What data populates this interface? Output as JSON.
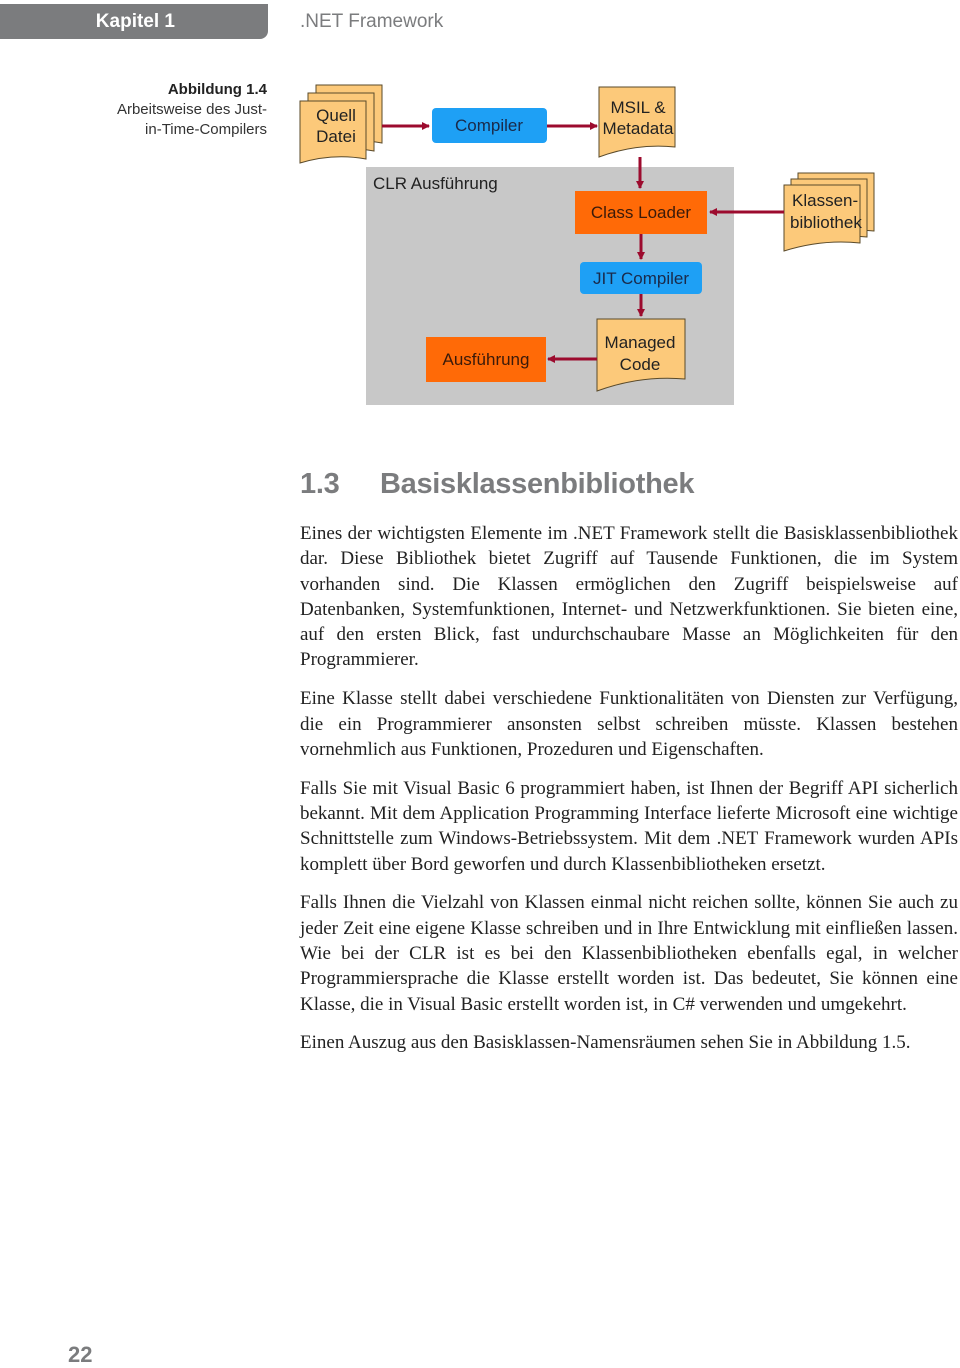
{
  "header": {
    "chapter_label": "Kapitel 1",
    "running_title": ".NET Framework"
  },
  "figure": {
    "number": "Abbildung 1.4",
    "caption_line1": "Arbeitsweise des Just-",
    "caption_line2": "in-Time-Compilers",
    "colors": {
      "document_fill": "#fcc97a",
      "process_blue": "#1ea0f5",
      "process_orange": "#ff6a07",
      "container_gray": "#c8c8c8",
      "arrow": "#9c0b2e"
    },
    "nodes": {
      "source_file": {
        "line1": "Quell",
        "line2": "Datei"
      },
      "compiler": "Compiler",
      "msil": {
        "line1": "MSIL &",
        "line2": "Metadata"
      },
      "clr_container": "CLR Ausführung",
      "class_loader": "Class Loader",
      "class_library": {
        "line1": "Klassen-",
        "line2": "bibliothek"
      },
      "jit_compiler": "JIT Compiler",
      "managed_code": {
        "line1": "Managed",
        "line2": "Code"
      },
      "execution": "Ausführung"
    }
  },
  "section": {
    "number": "1.3",
    "title": "Basisklassenbibliothek"
  },
  "paragraphs": [
    "Eines der wichtigsten Elemente im .NET Framework stellt die Basisklassenbibliothek dar. Diese Bibliothek bietet Zugriff auf Tausende Funktionen, die im System vorhanden sind. Die Klassen ermöglichen den Zugriff beispielsweise auf Datenbanken, Systemfunktionen, Internet- und Netzwerkfunktionen. Sie bieten eine, auf den ersten Blick, fast undurch­schaubare Masse an Möglichkeiten für den Programmierer.",
    "Eine Klasse stellt dabei verschiedene Funktionalitäten von Diensten zur Verfügung, die ein Programmierer ansonsten selbst schreiben müsste. Klas­sen bestehen vornehmlich aus Funktionen, Prozeduren und Eigenschaften.",
    "Falls Sie mit Visual Basic 6 programmiert haben, ist Ihnen der Begriff API sicherlich bekannt. Mit dem Application Programming Interface lieferte Microsoft eine wichtige Schnittstelle zum Windows-Betriebssystem. Mit dem .NET Framework wurden APIs komplett über Bord geworfen und durch Klas­senbibliotheken ersetzt.",
    "Falls Ihnen die Vielzahl von Klassen einmal nicht reichen sollte, können Sie auch zu jeder Zeit eine eigene Klasse schreiben und in Ihre Entwicklung mit einfließen lassen. Wie bei der CLR ist es bei den Klassenbibliotheken eben­falls egal, in welcher Programmiersprache die Klasse erstellt worden ist. Das bedeutet, Sie können eine Klasse, die in Visual Basic erstellt worden ist, in C# verwenden und umgekehrt.",
    "Einen Auszug aus den Basisklassen-Namensräumen sehen Sie in Abbildung 1.5."
  ],
  "footer": {
    "page_number": "22"
  }
}
